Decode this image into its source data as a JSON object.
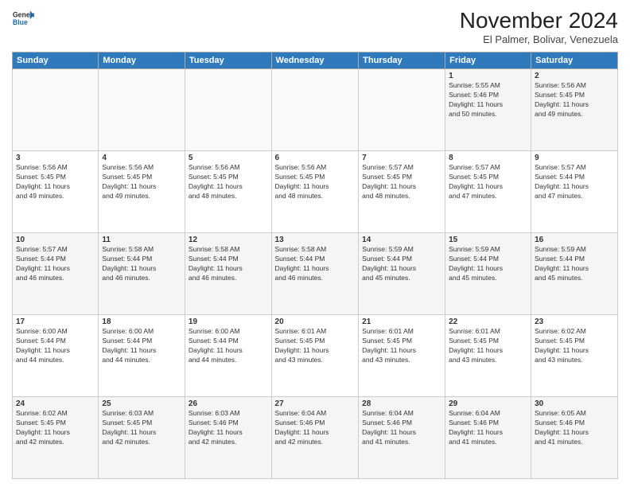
{
  "header": {
    "logo_general": "General",
    "logo_blue": "Blue",
    "month": "November 2024",
    "location": "El Palmer, Bolivar, Venezuela"
  },
  "days_of_week": [
    "Sunday",
    "Monday",
    "Tuesday",
    "Wednesday",
    "Thursday",
    "Friday",
    "Saturday"
  ],
  "weeks": [
    [
      {
        "day": "",
        "info": ""
      },
      {
        "day": "",
        "info": ""
      },
      {
        "day": "",
        "info": ""
      },
      {
        "day": "",
        "info": ""
      },
      {
        "day": "",
        "info": ""
      },
      {
        "day": "1",
        "info": "Sunrise: 5:55 AM\nSunset: 5:46 PM\nDaylight: 11 hours\nand 50 minutes."
      },
      {
        "day": "2",
        "info": "Sunrise: 5:56 AM\nSunset: 5:45 PM\nDaylight: 11 hours\nand 49 minutes."
      }
    ],
    [
      {
        "day": "3",
        "info": "Sunrise: 5:56 AM\nSunset: 5:45 PM\nDaylight: 11 hours\nand 49 minutes."
      },
      {
        "day": "4",
        "info": "Sunrise: 5:56 AM\nSunset: 5:45 PM\nDaylight: 11 hours\nand 49 minutes."
      },
      {
        "day": "5",
        "info": "Sunrise: 5:56 AM\nSunset: 5:45 PM\nDaylight: 11 hours\nand 48 minutes."
      },
      {
        "day": "6",
        "info": "Sunrise: 5:56 AM\nSunset: 5:45 PM\nDaylight: 11 hours\nand 48 minutes."
      },
      {
        "day": "7",
        "info": "Sunrise: 5:57 AM\nSunset: 5:45 PM\nDaylight: 11 hours\nand 48 minutes."
      },
      {
        "day": "8",
        "info": "Sunrise: 5:57 AM\nSunset: 5:45 PM\nDaylight: 11 hours\nand 47 minutes."
      },
      {
        "day": "9",
        "info": "Sunrise: 5:57 AM\nSunset: 5:44 PM\nDaylight: 11 hours\nand 47 minutes."
      }
    ],
    [
      {
        "day": "10",
        "info": "Sunrise: 5:57 AM\nSunset: 5:44 PM\nDaylight: 11 hours\nand 46 minutes."
      },
      {
        "day": "11",
        "info": "Sunrise: 5:58 AM\nSunset: 5:44 PM\nDaylight: 11 hours\nand 46 minutes."
      },
      {
        "day": "12",
        "info": "Sunrise: 5:58 AM\nSunset: 5:44 PM\nDaylight: 11 hours\nand 46 minutes."
      },
      {
        "day": "13",
        "info": "Sunrise: 5:58 AM\nSunset: 5:44 PM\nDaylight: 11 hours\nand 46 minutes."
      },
      {
        "day": "14",
        "info": "Sunrise: 5:59 AM\nSunset: 5:44 PM\nDaylight: 11 hours\nand 45 minutes."
      },
      {
        "day": "15",
        "info": "Sunrise: 5:59 AM\nSunset: 5:44 PM\nDaylight: 11 hours\nand 45 minutes."
      },
      {
        "day": "16",
        "info": "Sunrise: 5:59 AM\nSunset: 5:44 PM\nDaylight: 11 hours\nand 45 minutes."
      }
    ],
    [
      {
        "day": "17",
        "info": "Sunrise: 6:00 AM\nSunset: 5:44 PM\nDaylight: 11 hours\nand 44 minutes."
      },
      {
        "day": "18",
        "info": "Sunrise: 6:00 AM\nSunset: 5:44 PM\nDaylight: 11 hours\nand 44 minutes."
      },
      {
        "day": "19",
        "info": "Sunrise: 6:00 AM\nSunset: 5:44 PM\nDaylight: 11 hours\nand 44 minutes."
      },
      {
        "day": "20",
        "info": "Sunrise: 6:01 AM\nSunset: 5:45 PM\nDaylight: 11 hours\nand 43 minutes."
      },
      {
        "day": "21",
        "info": "Sunrise: 6:01 AM\nSunset: 5:45 PM\nDaylight: 11 hours\nand 43 minutes."
      },
      {
        "day": "22",
        "info": "Sunrise: 6:01 AM\nSunset: 5:45 PM\nDaylight: 11 hours\nand 43 minutes."
      },
      {
        "day": "23",
        "info": "Sunrise: 6:02 AM\nSunset: 5:45 PM\nDaylight: 11 hours\nand 43 minutes."
      }
    ],
    [
      {
        "day": "24",
        "info": "Sunrise: 6:02 AM\nSunset: 5:45 PM\nDaylight: 11 hours\nand 42 minutes."
      },
      {
        "day": "25",
        "info": "Sunrise: 6:03 AM\nSunset: 5:45 PM\nDaylight: 11 hours\nand 42 minutes."
      },
      {
        "day": "26",
        "info": "Sunrise: 6:03 AM\nSunset: 5:46 PM\nDaylight: 11 hours\nand 42 minutes."
      },
      {
        "day": "27",
        "info": "Sunrise: 6:04 AM\nSunset: 5:46 PM\nDaylight: 11 hours\nand 42 minutes."
      },
      {
        "day": "28",
        "info": "Sunrise: 6:04 AM\nSunset: 5:46 PM\nDaylight: 11 hours\nand 41 minutes."
      },
      {
        "day": "29",
        "info": "Sunrise: 6:04 AM\nSunset: 5:46 PM\nDaylight: 11 hours\nand 41 minutes."
      },
      {
        "day": "30",
        "info": "Sunrise: 6:05 AM\nSunset: 5:46 PM\nDaylight: 11 hours\nand 41 minutes."
      }
    ]
  ]
}
